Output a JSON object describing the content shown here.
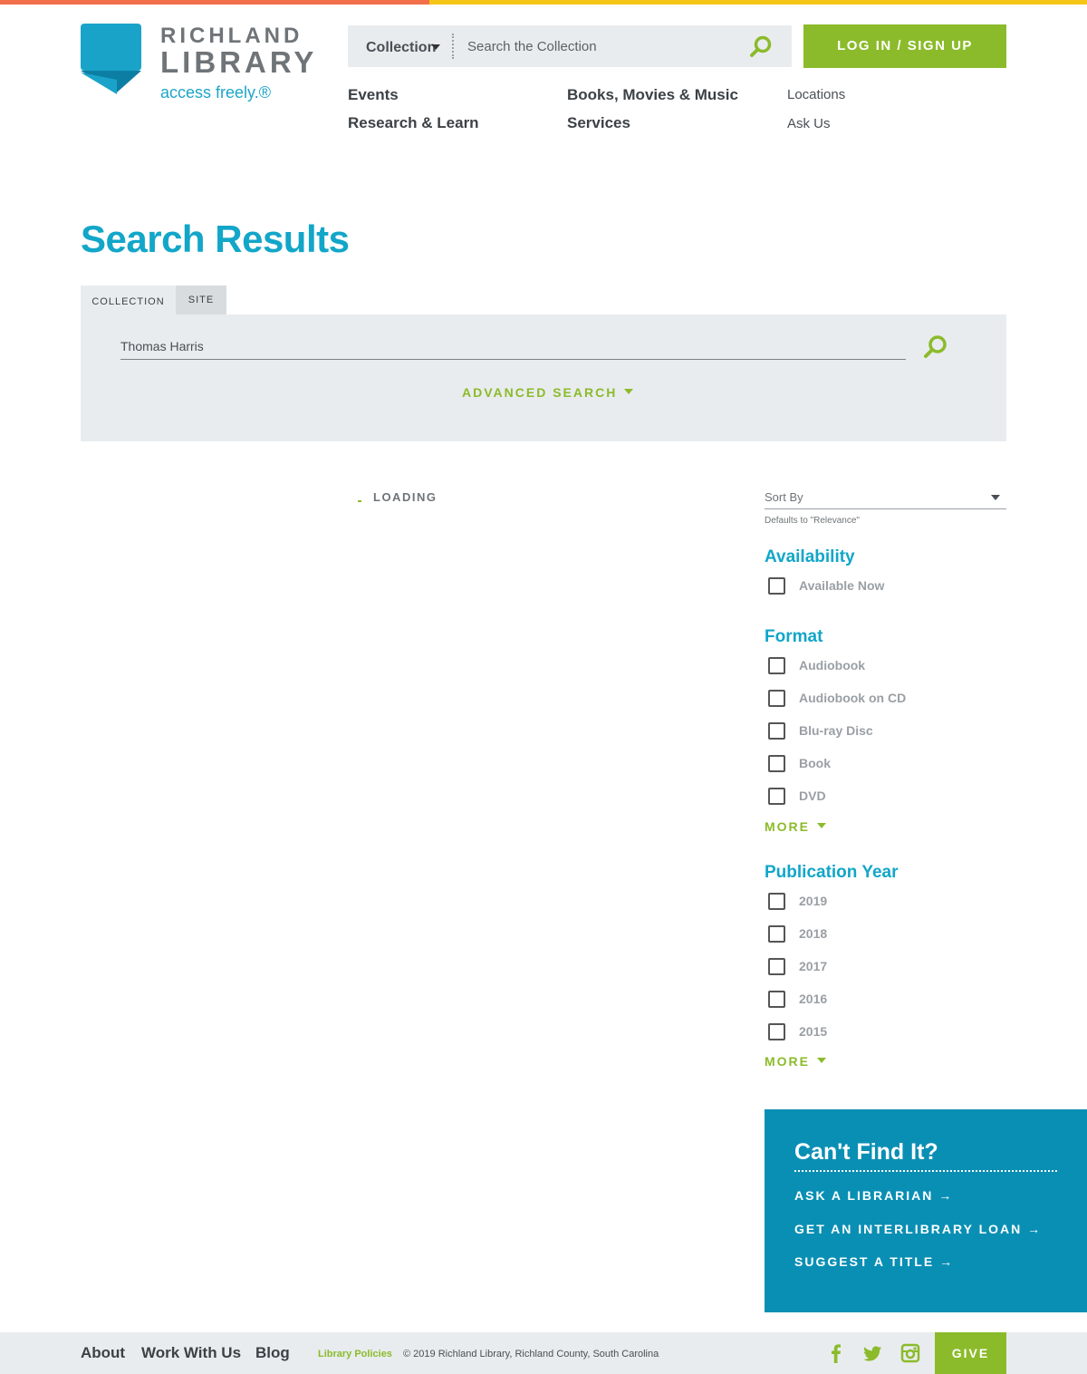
{
  "colors": {
    "top_bar_left": "#f26f4a",
    "top_bar_right": "#f5c518",
    "brand_blue": "#12a6c9",
    "accent_green": "#8bbb2a",
    "panel_blue": "#0a8fb4"
  },
  "logo": {
    "line1": "RICHLAND",
    "line2": "LIBRARY",
    "tagline": "access freely.®",
    "icon": "richland-library-logo-mark"
  },
  "header": {
    "search": {
      "scope_label": "Collection",
      "placeholder": "Search the Collection",
      "icon": "search-icon"
    },
    "login_label": "LOG IN / SIGN UP"
  },
  "nav": {
    "events": "Events",
    "research": "Research & Learn",
    "books": "Books, Movies & Music",
    "services": "Services",
    "locations": "Locations",
    "ask": "Ask Us"
  },
  "page_title": "Search Results",
  "tabs": {
    "collection": "COLLECTION",
    "site": "SITE"
  },
  "search_panel": {
    "query": "Thomas Harris",
    "advanced_label": "ADVANCED SEARCH"
  },
  "results": {
    "loading_label": "LOADING"
  },
  "sort": {
    "label": "Sort By",
    "hint": "Defaults to \"Relevance\""
  },
  "facets": {
    "availability": {
      "title": "Availability",
      "options": [
        "Available Now"
      ]
    },
    "format": {
      "title": "Format",
      "options": [
        "Audiobook",
        "Audiobook on CD",
        "Blu-ray Disc",
        "Book",
        "DVD"
      ],
      "more_label": "MORE"
    },
    "pub_year": {
      "title": "Publication Year",
      "options": [
        "2019",
        "2018",
        "2017",
        "2016",
        "2015"
      ],
      "more_label": "MORE"
    }
  },
  "cant_find": {
    "title": "Can't Find It?",
    "links": [
      "ASK A LIBRARIAN →",
      "GET AN INTERLIBRARY LOAN →",
      "SUGGEST A TITLE →"
    ]
  },
  "footer": {
    "about": "About",
    "work": "Work With Us",
    "blog": "Blog",
    "policies": "Library Policies",
    "copyright": "© 2019 Richland Library, Richland County, South Carolina",
    "social_icons": [
      "facebook-icon",
      "twitter-icon",
      "instagram-icon"
    ],
    "give": "GIVE"
  }
}
